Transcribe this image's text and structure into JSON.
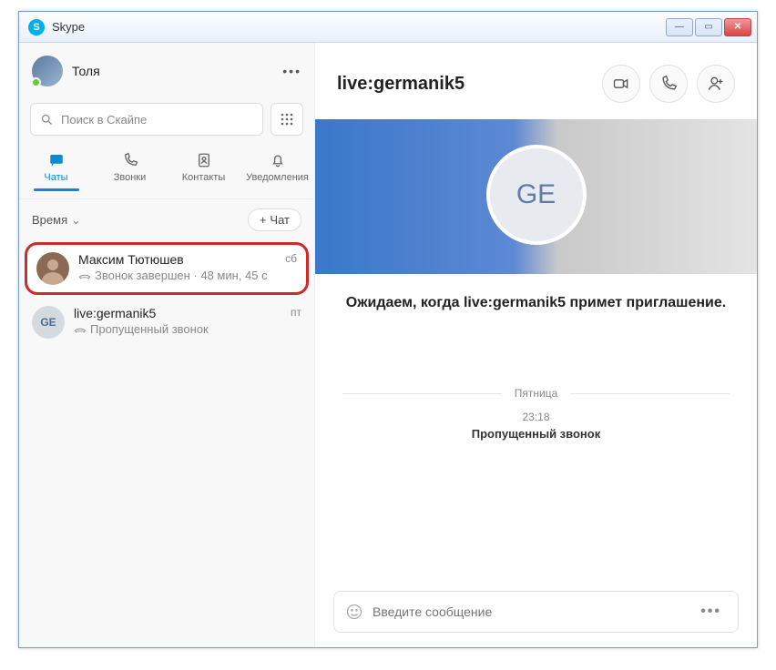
{
  "window": {
    "title": "Skype"
  },
  "profile": {
    "name": "Толя"
  },
  "search": {
    "placeholder": "Поиск в Скайпе"
  },
  "tabs": {
    "chats": "Чаты",
    "calls": "Звонки",
    "contacts": "Контакты",
    "notifications": "Уведомления"
  },
  "sort": {
    "label": "Время",
    "new_chat": "Чат"
  },
  "conversations": [
    {
      "name": "Максим Тютюшев",
      "date": "сб",
      "subtitle": "Звонок завершен · 48 мин, 45 с",
      "avatar_type": "photo",
      "highlighted": true
    },
    {
      "name": "live:germanik5",
      "date": "пт",
      "subtitle": "Пропущенный звонок",
      "avatar_type": "initials",
      "initials": "GE"
    }
  ],
  "chat": {
    "title": "live:germanik5",
    "avatar_initials": "GE",
    "invite_message": "Ожидаем, когда live:germanik5 примет приглашение.",
    "day_label": "Пятница",
    "missed": {
      "time": "23:18",
      "text": "Пропущенный звонок"
    },
    "composer_placeholder": "Введите сообщение"
  }
}
